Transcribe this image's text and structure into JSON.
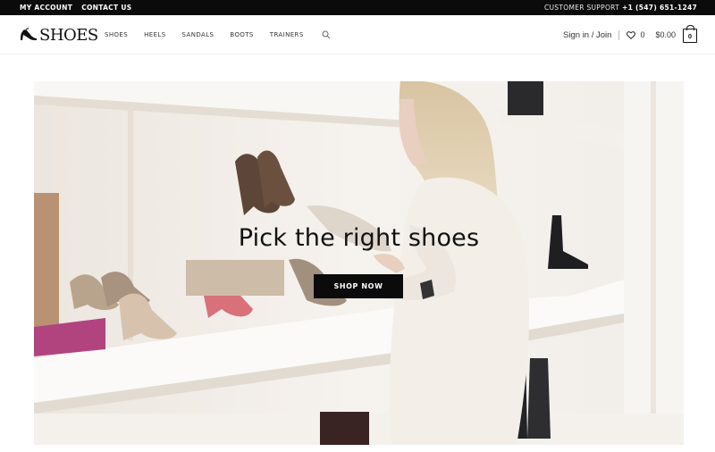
{
  "topbar": {
    "my_account": "MY ACCOUNT",
    "contact_us": "CONTACT US",
    "support_label": "CUSTOMER SUPPORT",
    "support_phone": "+1 (547) 651-1247"
  },
  "header": {
    "logo_text": "SHOES",
    "nav": {
      "shoes": "SHOES",
      "heels": "HEELS",
      "sandals": "SANDALS",
      "boots": "BOOTS",
      "trainers": "TRAINERS"
    },
    "signin": "Sign in / Join",
    "wishlist_count": "0",
    "cart_total": "$0.00",
    "cart_count": "0"
  },
  "hero": {
    "title": "Pick the right shoes",
    "button": "SHOP NOW"
  },
  "icons": {
    "logo": "high-heel-icon",
    "search": "search-icon",
    "wishlist": "heart-icon",
    "cart": "shopping-bag-icon"
  },
  "colors": {
    "topbar_bg": "#0b0b0b",
    "button_bg": "#0b0b0b",
    "text": "#111111"
  }
}
